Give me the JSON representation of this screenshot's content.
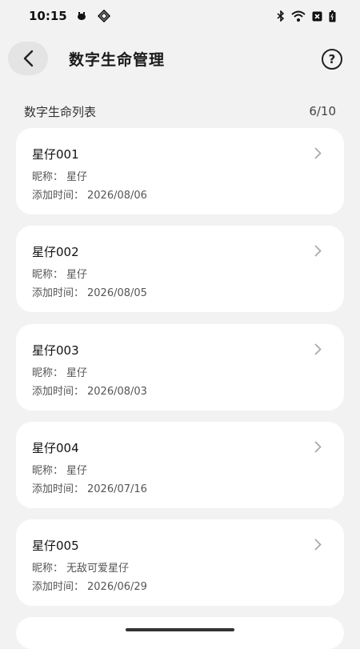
{
  "status_bar": {
    "time": "10:15"
  },
  "header": {
    "title": "数字生命管理",
    "help_glyph": "?"
  },
  "section": {
    "title": "数字生命列表",
    "count": "6/10"
  },
  "labels": {
    "nickname": "昵称：",
    "added": "添加时间："
  },
  "cards": [
    {
      "name": "星仔001",
      "nickname": "星仔",
      "date": "2026/08/06"
    },
    {
      "name": "星仔002",
      "nickname": "星仔",
      "date": "2026/08/05"
    },
    {
      "name": "星仔003",
      "nickname": "星仔",
      "date": "2026/08/03"
    },
    {
      "name": "星仔004",
      "nickname": "星仔",
      "date": "2026/07/16"
    },
    {
      "name": "星仔005",
      "nickname": "无敌可爱星仔",
      "date": "2026/06/29"
    }
  ]
}
